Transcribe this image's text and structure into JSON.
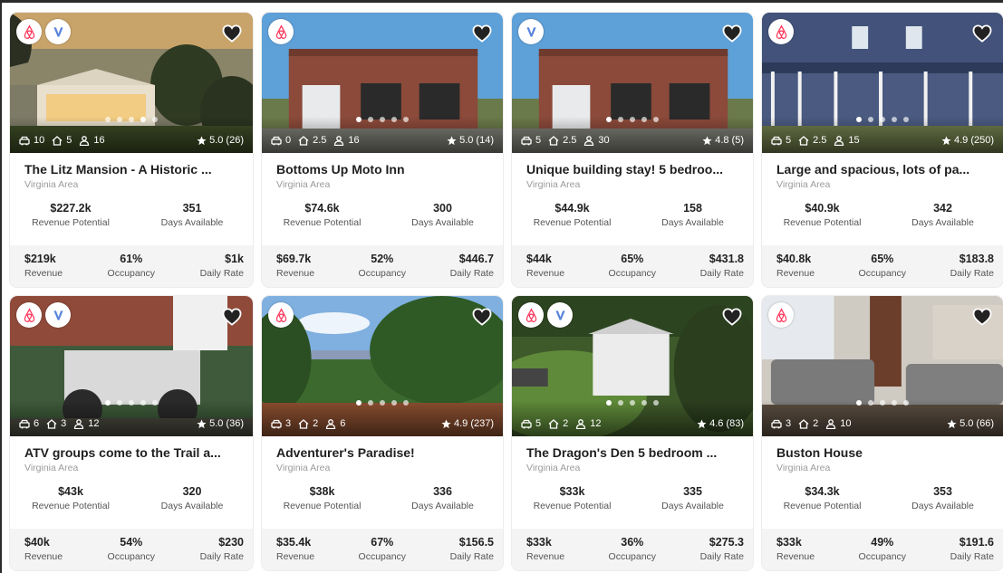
{
  "labels": {
    "revenue_potential": "Revenue Potential",
    "days_available": "Days Available",
    "revenue": "Revenue",
    "occupancy": "Occupancy",
    "daily_rate": "Daily Rate"
  },
  "listings": [
    {
      "title": "The Litz Mansion - A Historic ...",
      "area": "Virginia Area",
      "cars": "10",
      "bedrooms": "5",
      "guests": "16",
      "rating": "5.0 (26)",
      "revenue_potential": "$227.2k",
      "days_available": "351",
      "revenue": "$219k",
      "occupancy": "61%",
      "daily_rate": "$1k",
      "platforms": [
        "airbnb",
        "vrbo"
      ],
      "active_dot": 3,
      "scene": "mansion"
    },
    {
      "title": "Bottoms Up Moto Inn",
      "area": "Virginia Area",
      "cars": "0",
      "bedrooms": "2.5",
      "guests": "16",
      "rating": "5.0 (14)",
      "revenue_potential": "$74.6k",
      "days_available": "300",
      "revenue": "$69.7k",
      "occupancy": "52%",
      "daily_rate": "$446.7",
      "platforms": [
        "airbnb"
      ],
      "active_dot": 0,
      "scene": "brick"
    },
    {
      "title": "Unique building stay! 5 bedroo...",
      "area": "Virginia Area",
      "cars": "5",
      "bedrooms": "2.5",
      "guests": "30",
      "rating": "4.8 (5)",
      "revenue_potential": "$44.9k",
      "days_available": "158",
      "revenue": "$44k",
      "occupancy": "65%",
      "daily_rate": "$431.8",
      "platforms": [
        "vrbo"
      ],
      "active_dot": 0,
      "scene": "brick"
    },
    {
      "title": "Large and spacious, lots of pa...",
      "area": "Virginia Area",
      "cars": "5",
      "bedrooms": "2.5",
      "guests": "15",
      "rating": "4.9 (250)",
      "revenue_potential": "$40.9k",
      "days_available": "342",
      "revenue": "$40.8k",
      "occupancy": "65%",
      "daily_rate": "$183.8",
      "platforms": [
        "airbnb"
      ],
      "active_dot": 0,
      "scene": "farmhouse"
    },
    {
      "title": "ATV groups come to the Trail a...",
      "area": "Virginia Area",
      "cars": "6",
      "bedrooms": "3",
      "guests": "12",
      "rating": "5.0 (36)",
      "revenue_potential": "$43k",
      "days_available": "320",
      "revenue": "$40k",
      "occupancy": "54%",
      "daily_rate": "$230",
      "platforms": [
        "airbnb",
        "vrbo"
      ],
      "active_dot": 0,
      "scene": "atv"
    },
    {
      "title": "Adventurer's Paradise!",
      "area": "Virginia Area",
      "cars": "3",
      "bedrooms": "2",
      "guests": "6",
      "rating": "4.9 (237)",
      "revenue_potential": "$38k",
      "days_available": "336",
      "revenue": "$35.4k",
      "occupancy": "67%",
      "daily_rate": "$156.5",
      "platforms": [
        "airbnb"
      ],
      "active_dot": 0,
      "scene": "view"
    },
    {
      "title": "The Dragon's Den 5 bedroom ...",
      "area": "Virginia Area",
      "cars": "5",
      "bedrooms": "2",
      "guests": "12",
      "rating": "4.6 (83)",
      "revenue_potential": "$33k",
      "days_available": "335",
      "revenue": "$33k",
      "occupancy": "36%",
      "daily_rate": "$275.3",
      "platforms": [
        "airbnb",
        "vrbo"
      ],
      "active_dot": 0,
      "scene": "aerial"
    },
    {
      "title": "Buston House",
      "area": "Virginia Area",
      "cars": "3",
      "bedrooms": "2",
      "guests": "10",
      "rating": "5.0 (66)",
      "revenue_potential": "$34.3k",
      "days_available": "353",
      "revenue": "$33k",
      "occupancy": "49%",
      "daily_rate": "$191.6",
      "platforms": [
        "airbnb"
      ],
      "active_dot": 0,
      "scene": "interior"
    }
  ],
  "icons": {
    "airbnb_color": "#ff385c",
    "vrbo_color": "#3b6ed4",
    "favorite": "heart-icon",
    "cars": "car-icon",
    "bedrooms": "home-icon",
    "guests": "person-icon",
    "rating": "star-icon"
  }
}
